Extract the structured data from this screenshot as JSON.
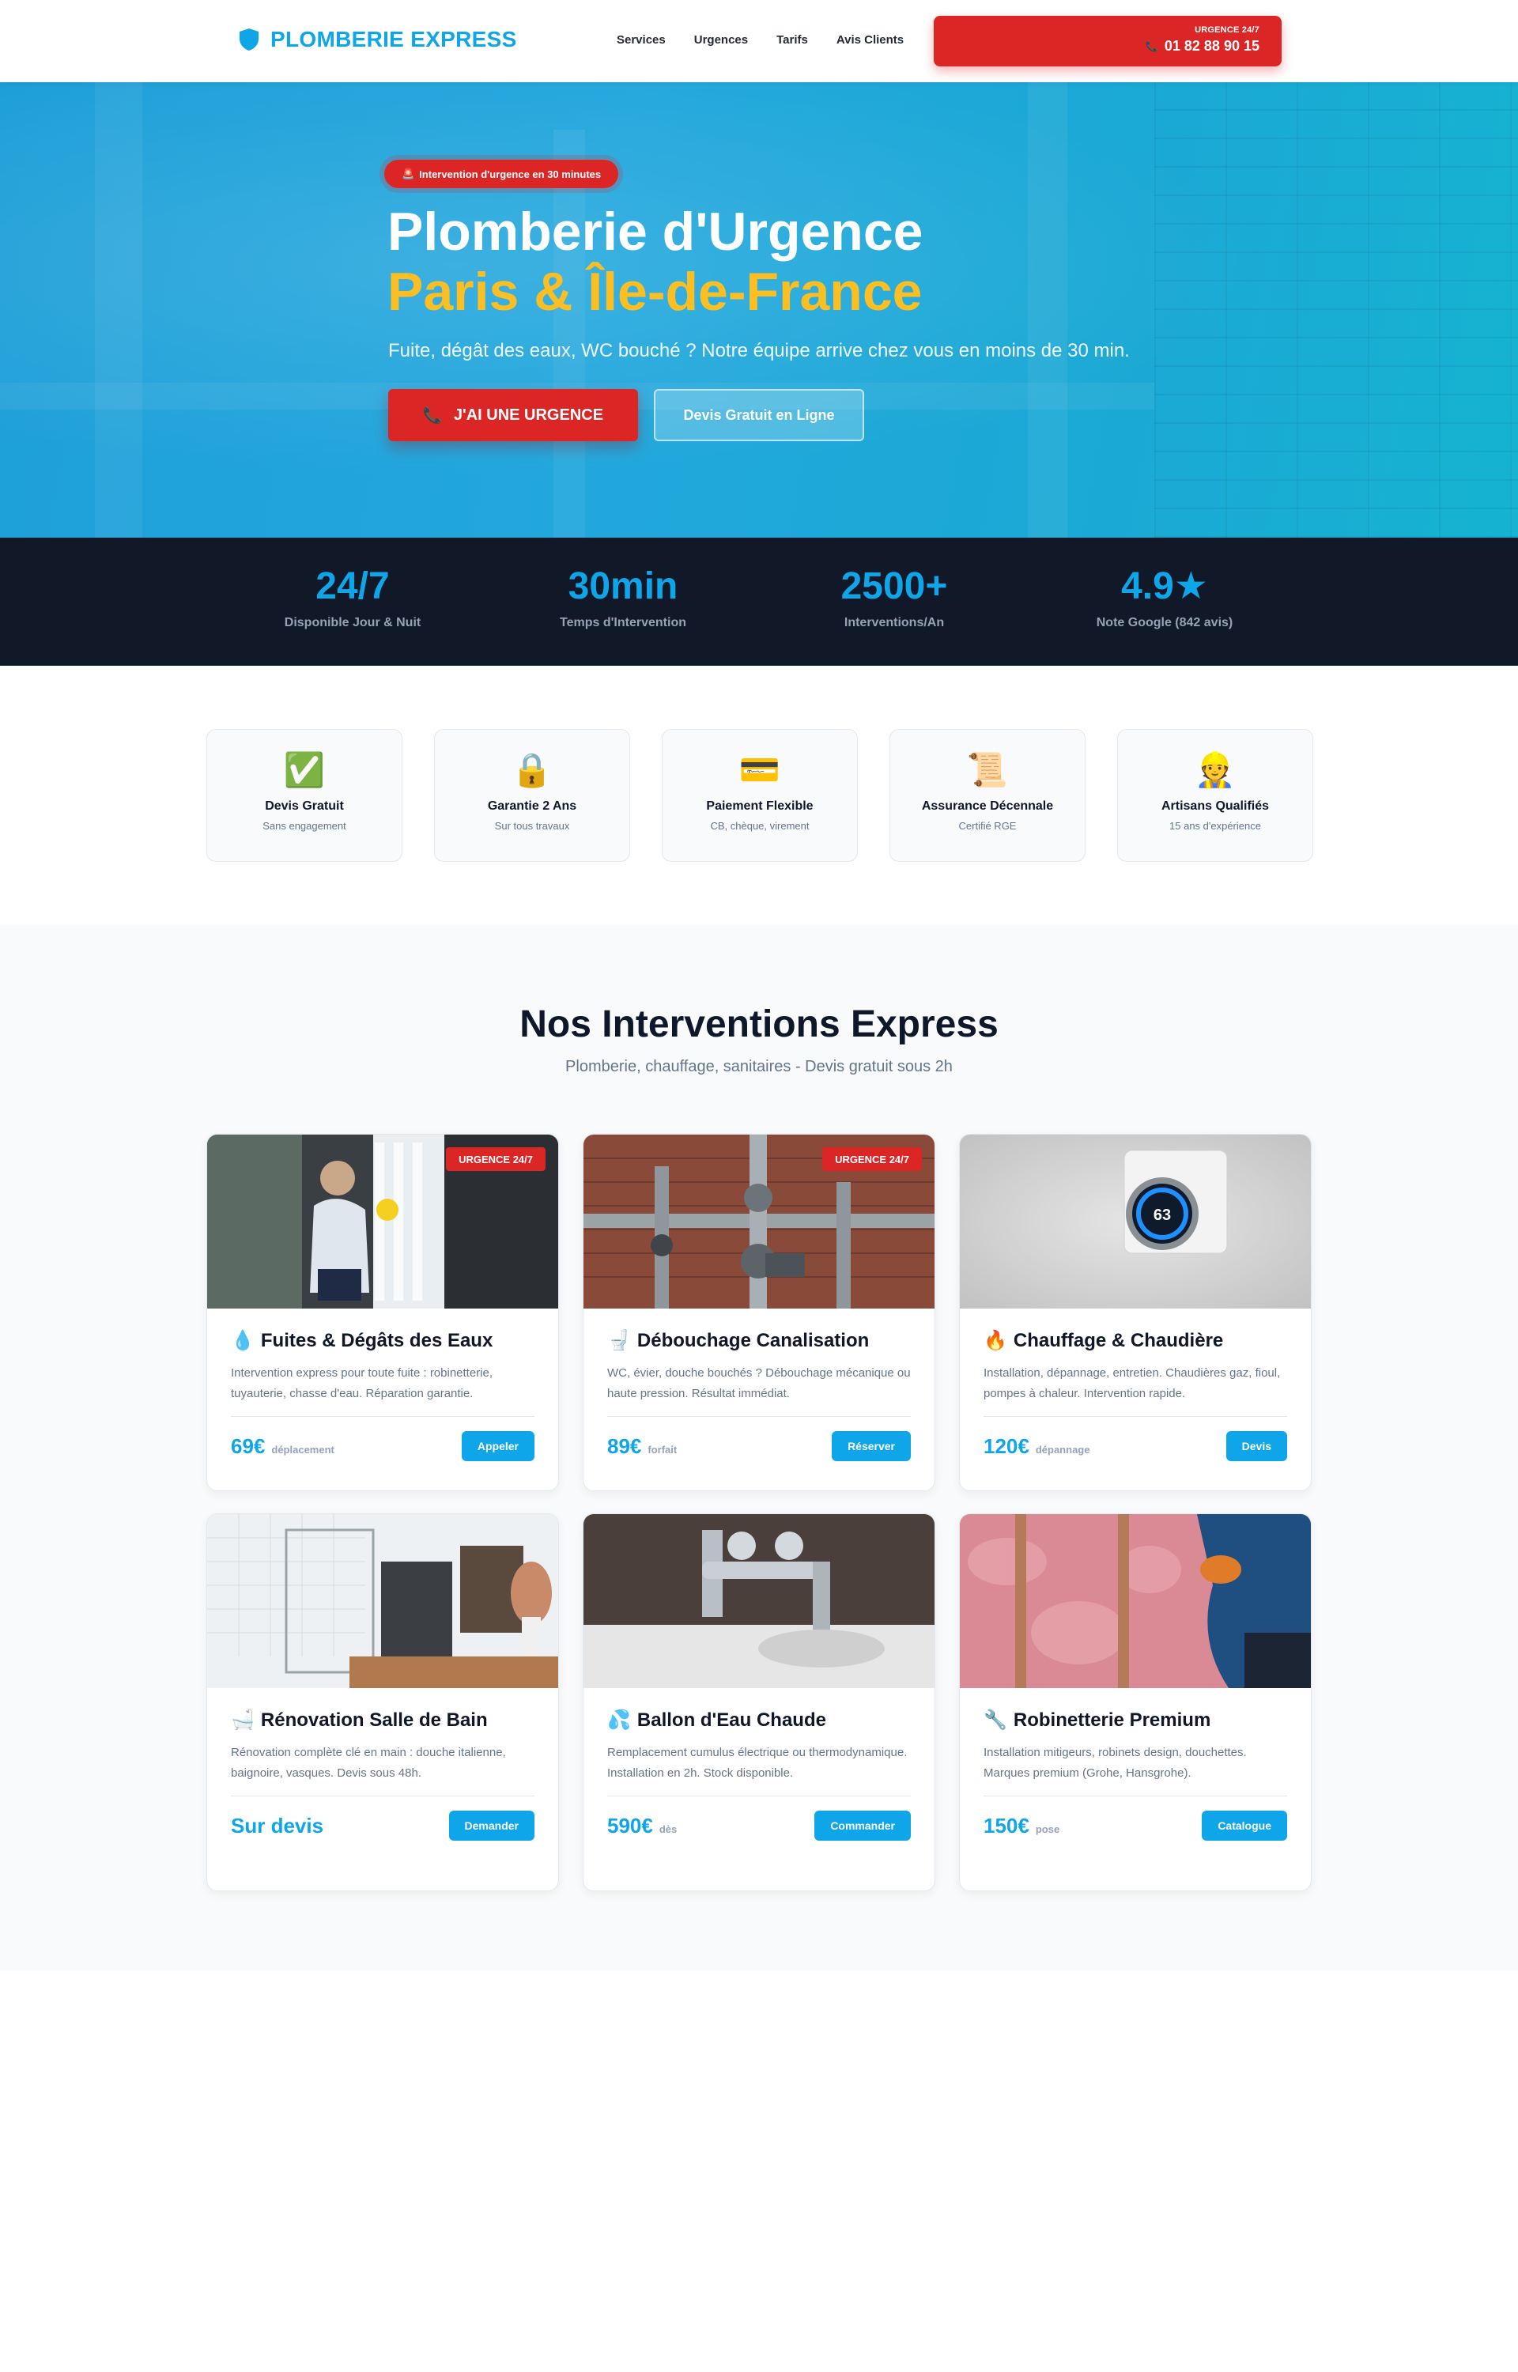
{
  "header": {
    "logo_text": "PLOMBERIE EXPRESS",
    "logo_icon": "shield-icon",
    "nav": [
      "Services",
      "Urgences",
      "Tarifs",
      "Avis Clients"
    ],
    "urgent_label": "URGENCE 24/7",
    "urgent_phone": "01 82 88 90 15",
    "urgent_icon": "phone-icon"
  },
  "hero": {
    "badge": "Intervention d'urgence en  30 minutes",
    "title": "Plomberie d'Urgence",
    "title_highlight": "Paris & Île-de-France",
    "subtitle": "Fuite, dégât des eaux, WC bouché ? Notre équipe arrive chez vous en moins de 30 min.",
    "btn_urgence": "J'AI UNE URGENCE",
    "btn_devis": "Devis Gratuit en Ligne"
  },
  "stats": [
    {
      "value": "24/7",
      "label": "Disponible Jour & Nuit"
    },
    {
      "value": "30min",
      "label": "Temps d'Intervention"
    },
    {
      "value": "2500+",
      "label": "Interventions/An"
    },
    {
      "value": "4.9★",
      "label": "Note Google (842 avis)"
    }
  ],
  "features": [
    {
      "icon": "✅",
      "title": "Devis Gratuit",
      "desc": "Sans engagement"
    },
    {
      "icon": "🔒",
      "title": "Garantie 2 Ans",
      "desc": "Sur tous travaux"
    },
    {
      "icon": "💳",
      "title": "Paiement Flexible",
      "desc": "CB, chèque, virement"
    },
    {
      "icon": "📜",
      "title": "Assurance Décennale",
      "desc": "Certifié RGE"
    },
    {
      "icon": "👷",
      "title": "Artisans Qualifiés",
      "desc": "15 ans d'expérience"
    }
  ],
  "services": {
    "title": "Nos Interventions Express",
    "subtitle": "Plomberie, chauffage, sanitaires - Devis gratuit sous 2h",
    "cards": [
      {
        "icon": "💧",
        "title": "Fuites & Dégâts des Eaux",
        "desc": "Intervention express pour toute fuite : robinetterie, tuyauterie, chasse d'eau. Réparation garantie.",
        "price": "69€",
        "unit": "déplacement",
        "button": "Appeler",
        "badge": "URGENCE 24/7"
      },
      {
        "icon": "🚽",
        "title": "Débouchage Canalisation",
        "desc": "WC, évier, douche bouchés ? Débouchage mécanique ou haute pression. Résultat immédiat.",
        "price": "89€",
        "unit": "forfait",
        "button": "Réserver",
        "badge": "URGENCE 24/7"
      },
      {
        "icon": "🔥",
        "title": "Chauffage & Chaudière",
        "desc": "Installation, dépannage, entretien. Chaudières gaz, fioul, pompes à chaleur. Intervention rapide.",
        "price": "120€",
        "unit": "dépannage",
        "button": "Devis",
        "thermostat": "63"
      },
      {
        "icon": "🛁",
        "title": "Rénovation Salle de Bain",
        "desc": "Rénovation complète clé en main : douche italienne, baignoire, vasques. Devis sous 48h.",
        "price": "Sur devis",
        "unit": "",
        "button": "Demander"
      },
      {
        "icon": "💦",
        "title": "Ballon d'Eau Chaude",
        "desc": "Remplacement cumulus électrique ou thermodynamique. Installation en 2h. Stock disponible.",
        "price": "590€",
        "unit": "dès",
        "button": "Commander"
      },
      {
        "icon": "🔧",
        "title": "Robinetterie Premium",
        "desc": "Installation mitigeurs, robinets design, douchettes. Marques premium (Grohe, Hansgrohe).",
        "price": "150€",
        "unit": "pose",
        "button": "Catalogue"
      }
    ]
  },
  "colors": {
    "brand": "#0ea5e9",
    "urgent": "#dc2626",
    "accent": "#fbbf24",
    "dark": "#111827"
  }
}
